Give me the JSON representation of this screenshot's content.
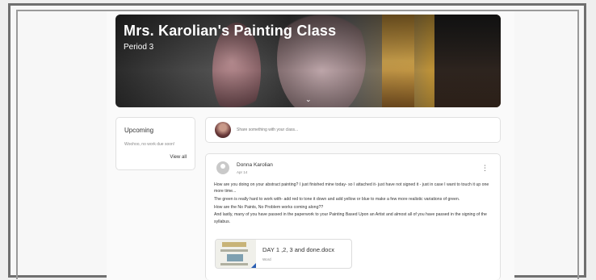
{
  "banner": {
    "title": "Mrs. Karolian's Painting Class",
    "subtitle": "Period 3",
    "expand_icon": "chevron-down-icon"
  },
  "upcoming": {
    "title": "Upcoming",
    "empty_text": "Woohoo, no work due soon!",
    "view_all": "View all"
  },
  "share": {
    "placeholder": "Share something with your class..."
  },
  "post": {
    "author": "Donna Karolian",
    "date": "Apr 14",
    "menu_icon": "more-vert-icon",
    "body_lines": [
      "How are you doing on your abstract painting? I just finished mine today- so I attached it- just have not signed it - just in case I want to touch it up one more time...",
      "The green is really hard to work with- add red to tone it down and add yellow or blue to make a few more realistic variations of green.",
      "How are the No Paints, No Problem works coming along??",
      "And lastly, many of you have passed in the paperwork to your Painting Based Upon an Artist and almost all of you have passed in the signing of the syllabus."
    ],
    "attachment": {
      "name": "DAY 1 ,2, 3 and done.docx",
      "type": "Word",
      "icon": "word-doc-icon"
    }
  }
}
